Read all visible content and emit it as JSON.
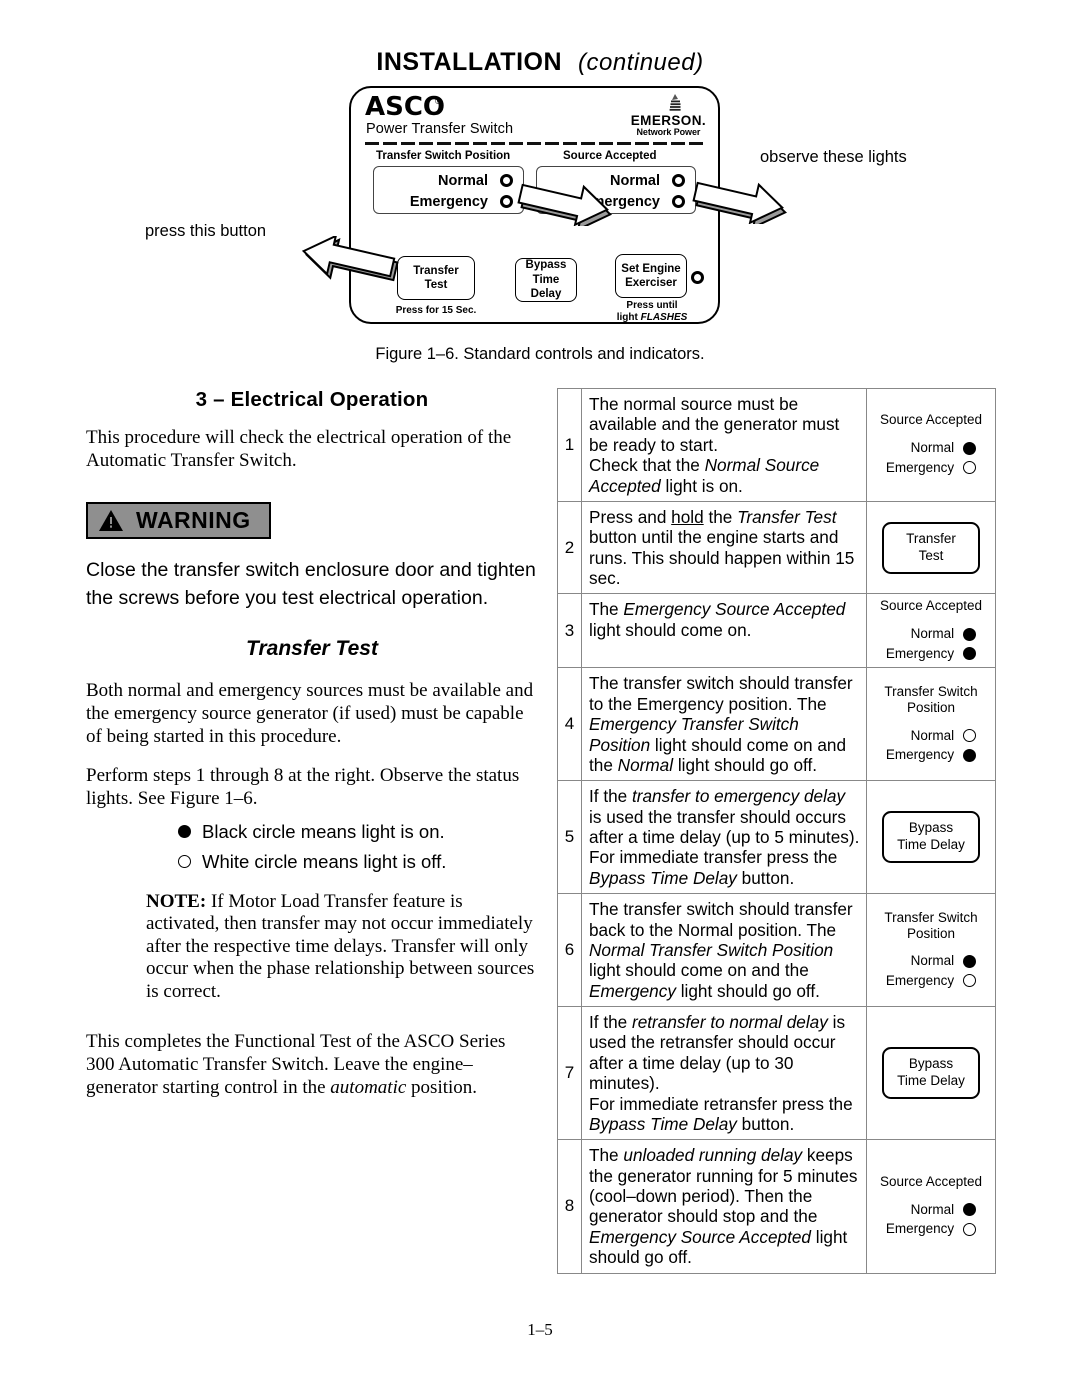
{
  "header": {
    "title": "INSTALLATION",
    "continued": "(continued)"
  },
  "figure": {
    "caption": "Figure 1–6.  Standard controls and indicators.",
    "faceplate": {
      "brand": "ASCO",
      "brand_reg": "®",
      "brand_sub": "Power Transfer Switch",
      "oem_name": "EMERSON.",
      "oem_sub": "Network Power",
      "groups": [
        {
          "label": "Transfer Switch Position",
          "rows": [
            {
              "label": "Normal",
              "state": "ring"
            },
            {
              "label": "Emergency",
              "state": "ring"
            }
          ]
        },
        {
          "label": "Source Accepted",
          "rows": [
            {
              "label": "Normal",
              "state": "ring"
            },
            {
              "label": "Emergency",
              "state": "ring"
            }
          ]
        }
      ],
      "buttons": [
        {
          "line1": "Transfer",
          "line2": "Test",
          "note": "Press for 15 Sec.",
          "has_led": false
        },
        {
          "line1": "Bypass",
          "line2": "Time Delay",
          "note": "",
          "has_led": false
        },
        {
          "line1": "Set Engine",
          "line2": "Exerciser",
          "note_line1": "Press until",
          "note_line2_plain": "light ",
          "note_line2_italic": "FLASHES",
          "has_led": true
        }
      ]
    },
    "callouts": {
      "left": "press this button",
      "right": "observe these lights"
    }
  },
  "left_column": {
    "section_heading": "3 – Electrical Operation",
    "intro": "This procedure will check the electrical operation of the Automatic Transfer Switch.",
    "warning": {
      "label": "WARNING",
      "body": "Close the transfer switch enclosure door and tighten the screws before you test electrical operation.",
      "bg_color": "#8f8f8f"
    },
    "subheading": "Transfer Test",
    "para_sources": "Both normal and emergency sources must be available and the emergency source generator (if used) must be capable of being started in this procedure.",
    "para_perform": "Perform steps 1 through 8 at the right.  Observe the status lights.  See Figure 1–6.",
    "legend": [
      {
        "state": "on",
        "text": "Black circle means light is on."
      },
      {
        "state": "off",
        "text": "White circle means light is off."
      }
    ],
    "note_label": "NOTE:",
    "note_text": "If Motor Load Transfer feature is activated, then transfer may not occur immediately after the respective time delays.  Transfer will only occur when the phase relationship between sources is correct.",
    "closing": "This completes the Functional Test of the ASCO Series 300 Automatic Transfer Switch.  Leave the engine–generator starting control in the automatic position."
  },
  "procedure_table": {
    "rows": [
      {
        "num": "1",
        "text_html": "The normal source must be available and the generator must be ready to start.<br>Check that the <i>Normal Source Accepted</i> light is on.",
        "indicator": {
          "kind": "lights",
          "title": "Source Accepted",
          "lines": [
            {
              "name": "Normal",
              "state": "on"
            },
            {
              "name": "Emergency",
              "state": "off"
            }
          ]
        }
      },
      {
        "num": "2",
        "text_html": "Press and <u>hold</u> the <i>Transfer Test</i> button until the engine starts and runs. This should happen within 15 sec.",
        "indicator": {
          "kind": "button",
          "line1": "Transfer",
          "line2": "Test"
        }
      },
      {
        "num": "3",
        "text_html": "The <i>Emergency Source Accepted</i> light should come on.",
        "indicator": {
          "kind": "lights",
          "title": "Source Accepted",
          "lines": [
            {
              "name": "Normal",
              "state": "on"
            },
            {
              "name": "Emergency",
              "state": "on"
            }
          ]
        }
      },
      {
        "num": "4",
        "text_html": "The transfer switch should transfer to the Emergency position. The <i>Emergency Transfer Switch Position</i> light should come on and the <i>Normal</i> light should go off.",
        "indicator": {
          "kind": "lights",
          "title": "Transfer Switch Position",
          "lines": [
            {
              "name": "Normal",
              "state": "off"
            },
            {
              "name": "Emergency",
              "state": "on"
            }
          ]
        }
      },
      {
        "num": "5",
        "text_html": "If the <i>transfer to emergency delay</i> is used the transfer should occurs after a time delay (up to 5 minutes).<br>For immediate transfer press the <i>Bypass Time Delay</i> button.",
        "indicator": {
          "kind": "button",
          "line1": "Bypass",
          "line2": "Time Delay"
        }
      },
      {
        "num": "6",
        "text_html": "The transfer switch should transfer back to the Normal position. The <i>Normal Transfer Switch Position</i> light should come on and the <i>Emergency</i> light should go off.",
        "indicator": {
          "kind": "lights",
          "title": "Transfer Switch Position",
          "lines": [
            {
              "name": "Normal",
              "state": "on"
            },
            {
              "name": "Emergency",
              "state": "off"
            }
          ]
        }
      },
      {
        "num": "7",
        "text_html": "If the <i>retransfer to normal delay</i> is used the retransfer should occur after a time delay (up to 30 minutes).<br>For immediate retransfer press the <i>Bypass Time Delay</i> button.",
        "indicator": {
          "kind": "button",
          "line1": "Bypass",
          "line2": "Time Delay"
        }
      },
      {
        "num": "8",
        "text_html": "The <i>unloaded running delay</i> keeps the generator running for 5 minutes (cool–down period). Then the generator should stop and the <i>Emergency Source Accepted</i> light should go off.",
        "indicator": {
          "kind": "lights",
          "title": "Source Accepted",
          "lines": [
            {
              "name": "Normal",
              "state": "on"
            },
            {
              "name": "Emergency",
              "state": "off"
            }
          ]
        }
      }
    ]
  },
  "folio": "1–5"
}
